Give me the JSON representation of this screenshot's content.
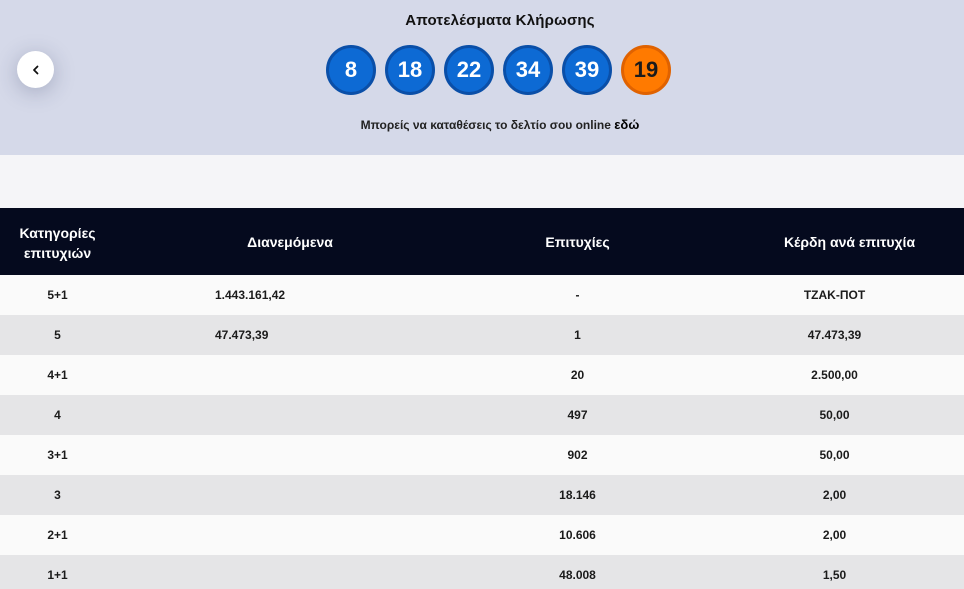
{
  "header": {
    "title": "Αποτελέσματα Κλήρωσης",
    "balls": [
      {
        "value": "8",
        "color": "#0d6ad4"
      },
      {
        "value": "18",
        "color": "#0d6ad4"
      },
      {
        "value": "22",
        "color": "#0d6ad4"
      },
      {
        "value": "34",
        "color": "#0d6ad4"
      },
      {
        "value": "39",
        "color": "#0d6ad4"
      },
      {
        "value": "19",
        "color": "#ff7a00"
      }
    ],
    "online_text": "Μπορείς να καταθέσεις το δελτίο σου online",
    "online_link": "εδώ",
    "back_icon": "chevron-left-icon"
  },
  "table": {
    "headers": {
      "categories_line1": "Κατηγορίες",
      "categories_line2": "επιτυχιών",
      "distributed": "Διανεμόμενα",
      "winners": "Επιτυχίες",
      "prize": "Κέρδη ανά επιτυχία"
    },
    "rows": [
      {
        "category": "5+1",
        "distributed": "1.443.161,42",
        "winners": "-",
        "prize": "ΤΖΑΚ-ΠΟΤ"
      },
      {
        "category": "5",
        "distributed": "47.473,39",
        "winners": "1",
        "prize": "47.473,39"
      },
      {
        "category": "4+1",
        "distributed": "",
        "winners": "20",
        "prize": "2.500,00"
      },
      {
        "category": "4",
        "distributed": "",
        "winners": "497",
        "prize": "50,00"
      },
      {
        "category": "3+1",
        "distributed": "",
        "winners": "902",
        "prize": "50,00"
      },
      {
        "category": "3",
        "distributed": "",
        "winners": "18.146",
        "prize": "2,00"
      },
      {
        "category": "2+1",
        "distributed": "",
        "winners": "10.606",
        "prize": "2,00"
      },
      {
        "category": "1+1",
        "distributed": "",
        "winners": "48.008",
        "prize": "1,50"
      }
    ]
  }
}
